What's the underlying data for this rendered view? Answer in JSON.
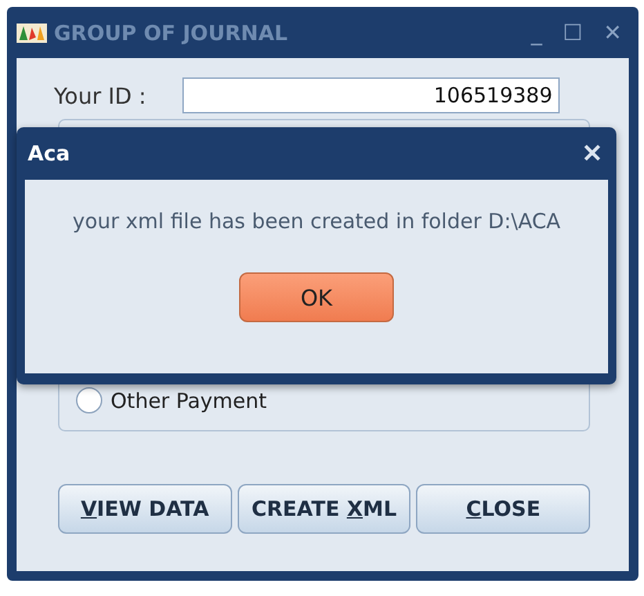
{
  "window": {
    "title": "GROUP OF JOURNAL",
    "controls": [
      "_",
      "☐",
      "✕"
    ]
  },
  "id_field": {
    "label": "Your ID :",
    "value": "106519389"
  },
  "payment_options": [
    {
      "label": "Other Payment",
      "selected": false
    }
  ],
  "buttons": [
    {
      "key": "V",
      "after": "IEW DATA"
    },
    {
      "before": "CREATE ",
      "key": "X",
      "after": "ML"
    },
    {
      "key": "C",
      "after": "LOSE"
    }
  ],
  "dialog": {
    "title": "Aca",
    "close": "✕",
    "message": "your xml file has been created in folder D:\\ACA",
    "button": "OK"
  }
}
